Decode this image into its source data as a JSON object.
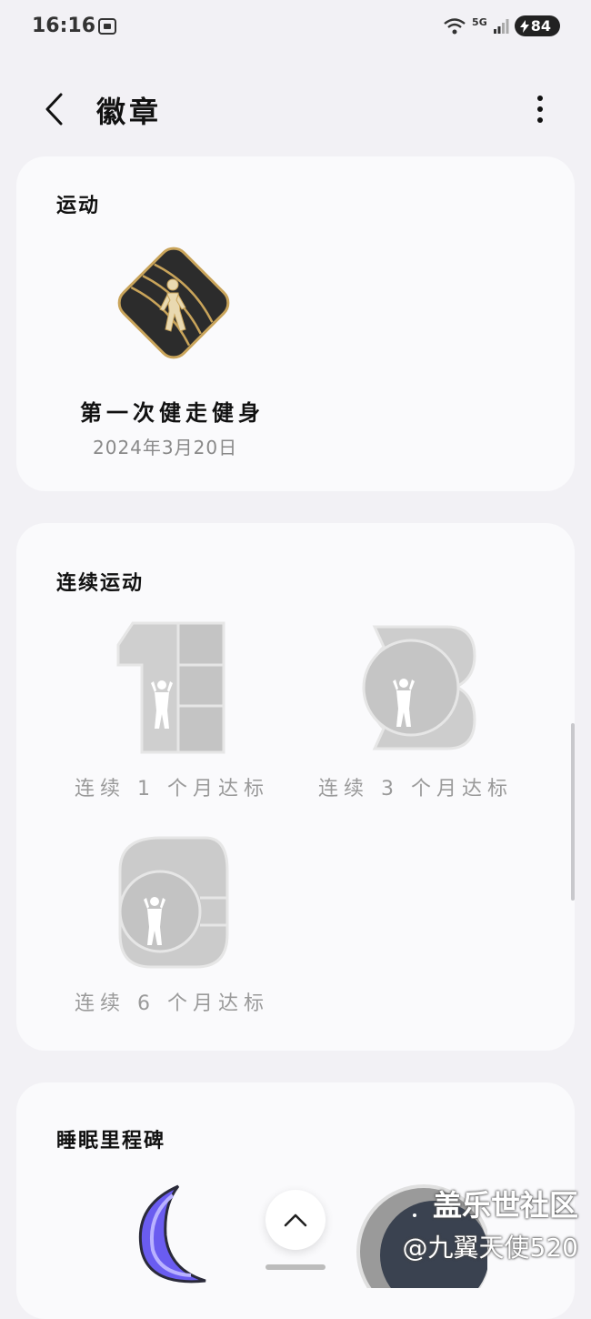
{
  "status_bar": {
    "time": "16:16",
    "network": "5G",
    "battery": "84"
  },
  "header": {
    "title": "徽章"
  },
  "sections": [
    {
      "title": "运动",
      "badges": [
        {
          "label": "第一次健走健身",
          "date": "2024年3月20日",
          "earned": true
        }
      ]
    },
    {
      "title": "连续运动",
      "badges": [
        {
          "label": "连续 1 个月达标",
          "number": "1",
          "earned": false
        },
        {
          "label": "连续 3 个月达标",
          "number": "3",
          "earned": false
        },
        {
          "label": "连续 6 个月达标",
          "number": "6",
          "earned": false
        }
      ]
    },
    {
      "title": "睡眠里程碑"
    }
  ],
  "watermark": {
    "line1": "盖乐世社区",
    "line2": "@九翼天使520"
  },
  "colors": {
    "background": "#f2f1f5",
    "card": "#fafafc",
    "locked_badge": "#c9c9c9",
    "earned_badge_gold": "#c9a45a",
    "sleep_badge_purple": "#6a5cf0"
  }
}
